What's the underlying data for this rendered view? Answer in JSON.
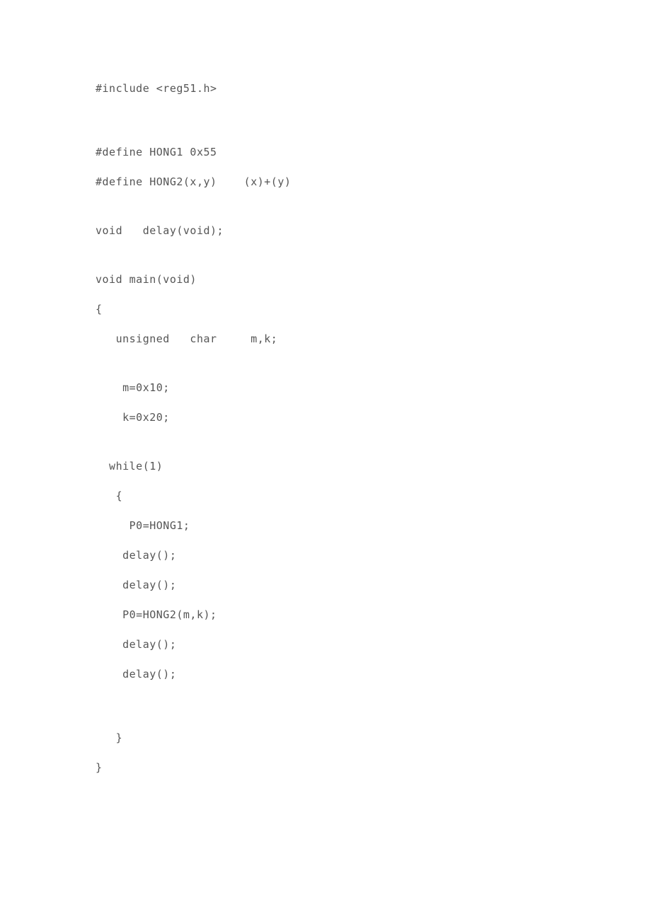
{
  "code": {
    "line1": "#include <reg51.h>",
    "line2": "#define HONG1 0x55",
    "line3": "#define HONG2(x,y)    (x)+(y)",
    "line4": "void   delay(void);",
    "line5": "void main(void)",
    "line6": "{",
    "line7": "   unsigned   char     m,k;",
    "line8": "    m=0x10;",
    "line9": "    k=0x20;",
    "line10": "  while(1)",
    "line11": "   {",
    "line12": "     P0=HONG1;",
    "line13": "    delay();",
    "line14": "    delay();",
    "line15": "    P0=HONG2(m,k);",
    "line16": "    delay();",
    "line17": "    delay();",
    "line18": "   }",
    "line19": "}"
  }
}
